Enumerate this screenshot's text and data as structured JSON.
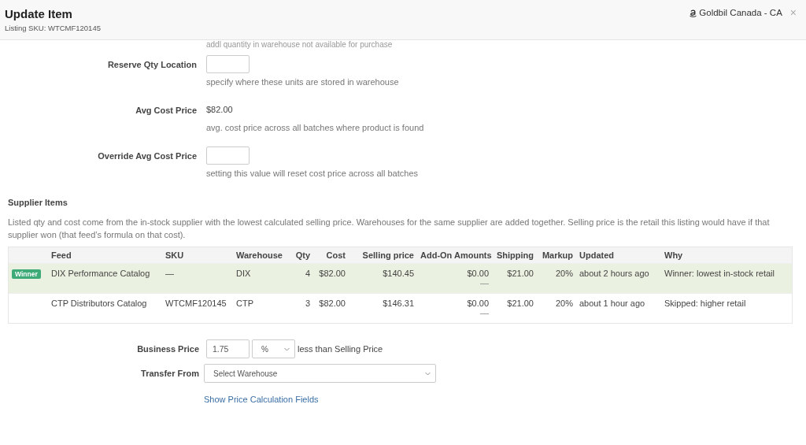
{
  "header": {
    "title": "Update Item",
    "subtitle": "Listing SKU: WTCMF120145",
    "store": "Goldbil Canada - CA",
    "close": "×"
  },
  "cut_hint": "addl quantity in warehouse not available for purchase",
  "fields": [
    {
      "kind": "input",
      "label": "Reserve Qty Location",
      "hint": "specify where these units are stored in warehouse"
    },
    {
      "kind": "text",
      "label": "Avg Cost Price",
      "value": "$82.00",
      "hint": "avg. cost price across all batches where product is found"
    },
    {
      "kind": "input",
      "label": "Override Avg Cost Price",
      "hint": "setting this value will reset cost price across all batches"
    }
  ],
  "supplier_items": {
    "title": "Supplier Items",
    "description": "Listed qty and cost come from the in-stock supplier with the lowest calculated selling price. Warehouses for the same supplier are added together. Selling price is the retail this listing would have if that supplier won (that feed’s formula on that cost).",
    "columns": [
      "Feed",
      "SKU",
      "Warehouse",
      "Qty",
      "Cost",
      "Selling price",
      "Add-On Amounts",
      "Shipping",
      "Markup",
      "Updated",
      "Why"
    ],
    "rows": [
      {
        "selected": true,
        "badge": "Winner",
        "cells": [
          "DIX Performance Catalog",
          "—",
          "DIX",
          "4",
          "$82.00",
          "$140.45",
          "$0.00",
          "$21.00",
          "20%",
          "about 2 hours ago",
          "Winner: lowest in-stock retail"
        ],
        "add_on_note": "—"
      },
      {
        "selected": false,
        "cells": [
          "CTP Distributors Catalog",
          "WTCMF120145",
          "CTP",
          "3",
          "$82.00",
          "$146.31",
          "$0.00",
          "$21.00",
          "20%",
          "about 1 hour ago",
          "Skipped: higher retail"
        ],
        "add_on_note": "—"
      }
    ]
  },
  "business_price": {
    "label": "Business Price",
    "value": "1.75",
    "unit": "%",
    "suffix": "less than Selling Price"
  },
  "transfer_from": {
    "label": "Transfer From",
    "placeholder": "Select Warehouse"
  },
  "link": "Show Price Calculation Fields"
}
